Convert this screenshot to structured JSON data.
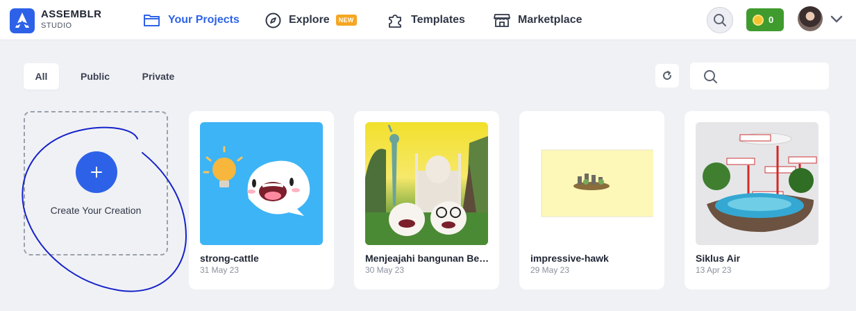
{
  "brand": {
    "name": "ASSEMBLR",
    "sub": "STUDIO"
  },
  "nav": {
    "projects": "Your Projects",
    "explore": "Explore",
    "explore_badge": "NEW",
    "templates": "Templates",
    "marketplace": "Marketplace"
  },
  "wallet": {
    "coins": "0"
  },
  "filters": {
    "all": "All",
    "public": "Public",
    "private": "Private"
  },
  "search": {
    "placeholder": ""
  },
  "create": {
    "label": "Create Your Creation"
  },
  "projects": [
    {
      "title": "strong-cattle",
      "date": "31 May 23"
    },
    {
      "title": "Menjeajahi bangunan Ber...",
      "date": "30 May 23"
    },
    {
      "title": "impressive-hawk",
      "date": "29 May 23"
    },
    {
      "title": "Siklus Air",
      "date": "13 Apr 23"
    }
  ],
  "colors": {
    "accent": "#2d62e8",
    "badge": "#f5a623",
    "coins": "#3f9b2e",
    "background": "#f0f1f5"
  },
  "icons": {
    "projects": "folder-icon",
    "explore": "compass-icon",
    "templates": "puzzle-icon",
    "marketplace": "store-icon"
  }
}
